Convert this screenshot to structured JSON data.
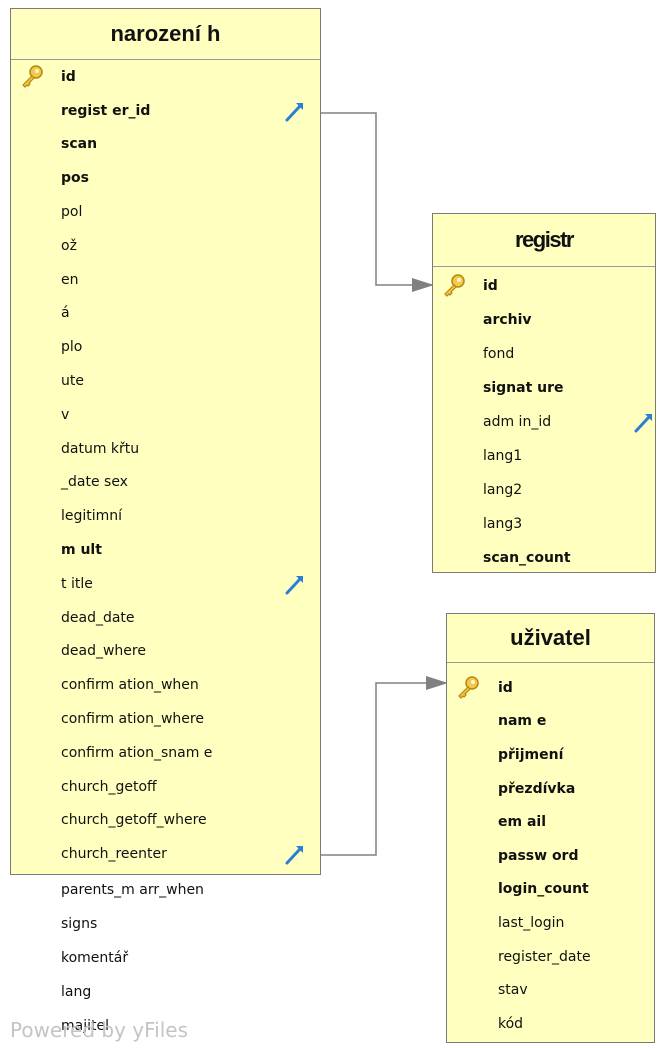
{
  "tables": {
    "narozeni": {
      "title": "narození h",
      "rows": [
        {
          "label": "id",
          "pk": true,
          "fk": false,
          "bold": true
        },
        {
          "label": "regist er_id",
          "pk": false,
          "fk": true,
          "bold": true
        },
        {
          "label": "scan",
          "pk": false,
          "fk": false,
          "bold": true
        },
        {
          "label": "pos",
          "pk": false,
          "fk": false,
          "bold": true
        },
        {
          "label": "pol",
          "pk": false,
          "fk": false,
          "bold": false
        },
        {
          "label": "ož",
          "pk": false,
          "fk": false,
          "bold": false
        },
        {
          "label": "en",
          "pk": false,
          "fk": false,
          "bold": false
        },
        {
          "label": "á",
          "pk": false,
          "fk": false,
          "bold": false
        },
        {
          "label": "plo",
          "pk": false,
          "fk": false,
          "bold": false
        },
        {
          "label": "ute",
          "pk": false,
          "fk": false,
          "bold": false
        },
        {
          "label": "v",
          "pk": false,
          "fk": false,
          "bold": false
        },
        {
          "label": "datum křtu",
          "pk": false,
          "fk": false,
          "bold": false
        },
        {
          "label": "_date sex",
          "pk": false,
          "fk": false,
          "bold": false
        },
        {
          "label": "legitimní",
          "pk": false,
          "fk": false,
          "bold": false
        },
        {
          "label": "m ult",
          "pk": false,
          "fk": false,
          "bold": true
        },
        {
          "label": "t itle",
          "pk": false,
          "fk": true,
          "bold": false
        },
        {
          "label": "dead_date",
          "pk": false,
          "fk": false,
          "bold": false
        },
        {
          "label": "dead_where",
          "pk": false,
          "fk": false,
          "bold": false
        },
        {
          "label": "confirm ation_when",
          "pk": false,
          "fk": false,
          "bold": false
        },
        {
          "label": "confirm ation_where",
          "pk": false,
          "fk": false,
          "bold": false
        },
        {
          "label": "confirm ation_snam e",
          "pk": false,
          "fk": false,
          "bold": false
        },
        {
          "label": "church_getoff",
          "pk": false,
          "fk": false,
          "bold": false
        },
        {
          "label": "church_getoff_where",
          "pk": false,
          "fk": false,
          "bold": false
        },
        {
          "label": "church_reenter",
          "pk": false,
          "fk": true,
          "bold": false
        }
      ],
      "overflow_rows": [
        "parents_m arr_when",
        "signs",
        "komentář",
        "lang",
        "majitel"
      ]
    },
    "registr": {
      "title": "registr",
      "rows": [
        {
          "label": "id",
          "pk": true,
          "fk": false,
          "bold": true
        },
        {
          "label": "archiv",
          "pk": false,
          "fk": false,
          "bold": true
        },
        {
          "label": "fond",
          "pk": false,
          "fk": false,
          "bold": false
        },
        {
          "label": "signat ure",
          "pk": false,
          "fk": false,
          "bold": true
        },
        {
          "label": "adm in_id",
          "pk": false,
          "fk": true,
          "bold": false
        },
        {
          "label": "lang1",
          "pk": false,
          "fk": false,
          "bold": false
        },
        {
          "label": "lang2",
          "pk": false,
          "fk": false,
          "bold": false
        },
        {
          "label": "lang3",
          "pk": false,
          "fk": false,
          "bold": false
        },
        {
          "label": "scan_count",
          "pk": false,
          "fk": false,
          "bold": true
        }
      ]
    },
    "uzivatel": {
      "title": "uživatel",
      "rows": [
        {
          "label": "id",
          "pk": true,
          "fk": false,
          "bold": true
        },
        {
          "label": "nam e",
          "pk": false,
          "fk": false,
          "bold": true
        },
        {
          "label": "přijmení",
          "pk": false,
          "fk": false,
          "bold": true
        },
        {
          "label": "přezdívka",
          "pk": false,
          "fk": false,
          "bold": true
        },
        {
          "label": "em ail",
          "pk": false,
          "fk": false,
          "bold": true
        },
        {
          "label": "passw ord",
          "pk": false,
          "fk": false,
          "bold": true
        },
        {
          "label": "login_count",
          "pk": false,
          "fk": false,
          "bold": true
        },
        {
          "label": "last_login",
          "pk": false,
          "fk": false,
          "bold": false
        },
        {
          "label": "register_date",
          "pk": false,
          "fk": false,
          "bold": false
        },
        {
          "label": "stav",
          "pk": false,
          "fk": false,
          "bold": false
        },
        {
          "label": "kód",
          "pk": false,
          "fk": false,
          "bold": false
        }
      ]
    }
  },
  "relations": [
    {
      "from": "narozeni.regist er_id",
      "to": "registr.id"
    },
    {
      "from": "narozeni.church_reenter",
      "to": "uzivatel.id"
    }
  ],
  "watermark": "Powered by yFiles",
  "colors": {
    "table_fill": "#ffffc0",
    "border": "#7a7a7a",
    "connector": "#808080",
    "key_icon": "#d9a52a",
    "fk_icon": "#2a7fd4"
  }
}
